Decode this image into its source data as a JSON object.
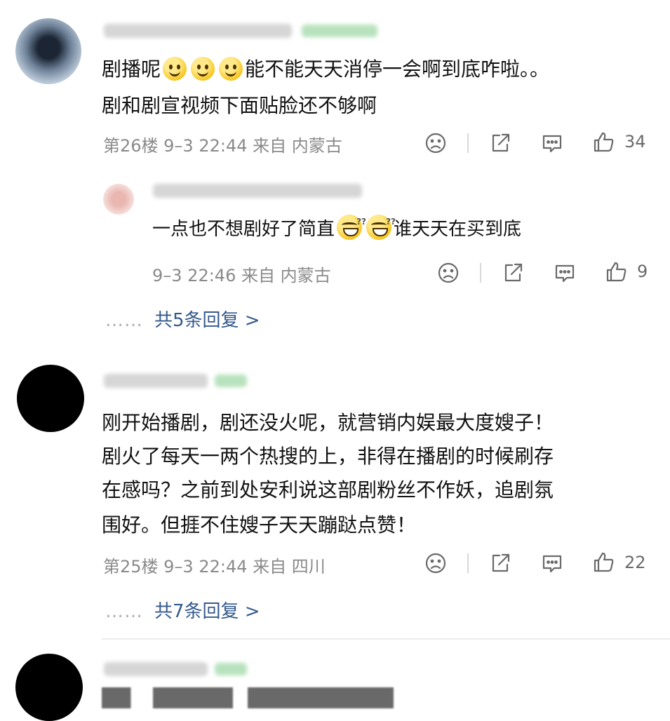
{
  "comments": [
    {
      "text_line1_before": "剧播呢",
      "text_line1_after": "能不能天天消停一会啊到底咋啦。。",
      "text_line2": "剧和剧宣视频下面贴脸还不够啊",
      "meta": "第26楼 9–3 22:44 来自 内蒙古",
      "likes": "34"
    },
    {
      "text_line1": "刚开始播剧，剧还没火呢，就营销内娱最大度嫂子！",
      "text_line2": "剧火了每天一两个热搜的上，非得在播剧的时候刷存",
      "text_line3": "在感吗？之前到处安利说这部剧粉丝不作妖，追剧氛",
      "text_line4": "围好。但捱不住嫂子天天蹦跶点赞！",
      "meta": "第25楼 9–3 22:44 来自 四川",
      "likes": "22"
    }
  ],
  "reply": {
    "text_before": "一点也不想剧好了简直",
    "text_after": "谁天天在买到底",
    "meta": "9–3 22:46 来自 内蒙古",
    "likes": "9"
  },
  "more_replies": [
    {
      "dots": "……",
      "label": "共5条回复 >"
    },
    {
      "dots": "……",
      "label": "共7条回复 >"
    }
  ],
  "icons": [
    "sad-face-icon",
    "share-icon",
    "comment-icon",
    "thumbs-up-icon"
  ]
}
